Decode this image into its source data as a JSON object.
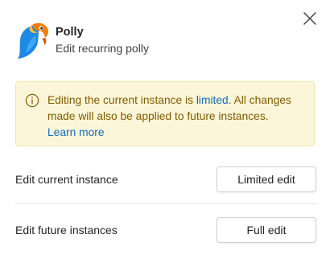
{
  "header": {
    "app_name": "Polly",
    "subtitle": "Edit recurring polly",
    "logo_icon": "parrot-logo"
  },
  "close_icon": "close-icon",
  "banner": {
    "icon": "info-icon",
    "text_before": "Editing the current instance is ",
    "link_limited": "limited",
    "text_after": ". All changes made will also be applied to future instances.",
    "link_learn_more": "Learn more"
  },
  "options": [
    {
      "label": "Edit current instance",
      "button": "Limited edit"
    },
    {
      "label": "Edit future instances",
      "button": "Full edit"
    }
  ],
  "colors": {
    "banner_bg": "#fbf6d9",
    "banner_border": "#f2e6a6",
    "banner_text": "#835b00",
    "link": "#0f6cbd",
    "logo_blue": "#1e88e5",
    "logo_orange": "#f57c00",
    "logo_yellow": "#fbc02d"
  }
}
